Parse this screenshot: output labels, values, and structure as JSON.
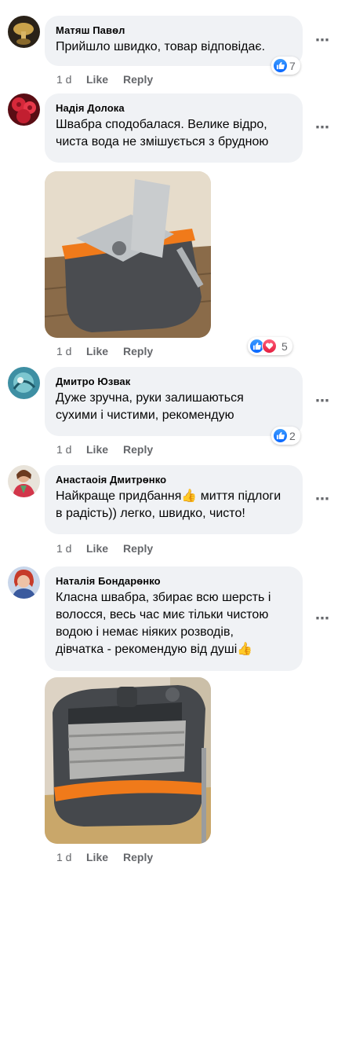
{
  "comments": [
    {
      "author": "Матяш Павѳл",
      "text": "Прийшло швидко, товар відповідає.",
      "age": "1 d",
      "like_label": "Like",
      "reply_label": "Reply",
      "reaction_count": "7",
      "avatar": "avatar-gold-figure"
    },
    {
      "author": "Надія Долока",
      "text": "Швабра сподобалася. Велике відро,\nчиста вода не змішується з брудною",
      "age": "1 d",
      "like_label": "Like",
      "reply_label": "Reply",
      "reaction_count": "5",
      "avatar": "avatar-red-flowers",
      "photo": "mop-bucket-photo"
    },
    {
      "author": "Дмитро Юзвак",
      "text": "Дуже зручна, руки залишаються\nсухими і чистими, рекомендую",
      "age": "1 d",
      "like_label": "Like",
      "reply_label": "Reply",
      "reaction_count": "2",
      "avatar": "avatar-blue-art"
    },
    {
      "author": "Анастаоія Дмитрѳнко",
      "text": "Найкраще придбання👍 миття підлоги\nв радість)) легко, швидко, чисто!",
      "age": "1 d",
      "like_label": "Like",
      "reply_label": "Reply",
      "avatar": "avatar-woman-red"
    },
    {
      "author": "Наталія Бондарѳнко",
      "text": "Класна швабра, збирає всю шерсть і\nволосся, весь час миє тільки чистою\nводою і немає ніяких розводів,\nдівчатка - рекомендую від душі👍",
      "age": "1 d",
      "like_label": "Like",
      "reply_label": "Reply",
      "avatar": "avatar-woman-blue",
      "photo": "mop-bucket-top-photo"
    }
  ],
  "more_icon": "⋯",
  "colors": {
    "bubble": "#f0f2f5",
    "like_blue": "#0866ff",
    "love_red": "#e41e3f",
    "meta_gray": "#65676b",
    "bucket_orange": "#f07a1a"
  }
}
